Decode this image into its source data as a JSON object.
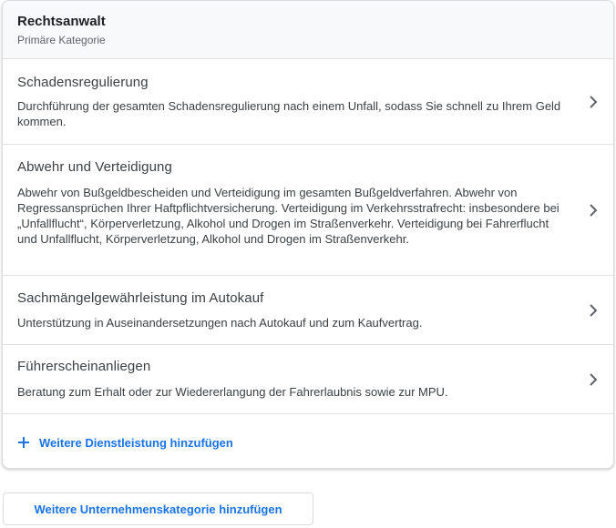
{
  "header": {
    "title": "Rechtsanwalt",
    "subtitle": "Primäre Kategorie"
  },
  "services": [
    {
      "title": "Schadensregulierung",
      "description": "Durchführung der gesamten Schadensregulierung nach einem Unfall, sodass Sie schnell zu Ihrem Geld kommen."
    },
    {
      "title": "Abwehr und Verteidigung",
      "description": "Abwehr von Bußgeldbescheiden und Verteidigung im gesamten Bußgeldverfahren. Abwehr von Regressansprüchen Ihrer Haftpflichtversicherung. Verteidigung im Verkehrsstrafrecht: insbesondere bei „Unfallflucht“, Körperverletzung, Alkohol und Drogen im Straßenverkehr. Verteidigung bei Fahrerflucht und Unfallflucht, Körperverletzung, Alkohol und Drogen im Straßenverkehr."
    },
    {
      "title": "Sachmängelgewährleistung im Autokauf",
      "description": "Unterstützung in Auseinandersetzungen nach Autokauf und zum Kaufvertrag."
    },
    {
      "title": "Führerscheinanliegen",
      "description": "Beratung zum Erhalt oder zur Wiedererlangung der Fahrerlaubnis sowie zur MPU."
    }
  ],
  "actions": {
    "add_service_label": "Weitere Dienstleistung hinzufügen",
    "add_category_label": "Weitere Unternehmenskategorie hinzufügen"
  },
  "icons": {
    "chevron": "chevron-right-icon",
    "plus": "plus-icon"
  },
  "colors": {
    "accent": "#1a73e8",
    "text": "#3c4043",
    "header_bg": "#f8f9fa"
  }
}
